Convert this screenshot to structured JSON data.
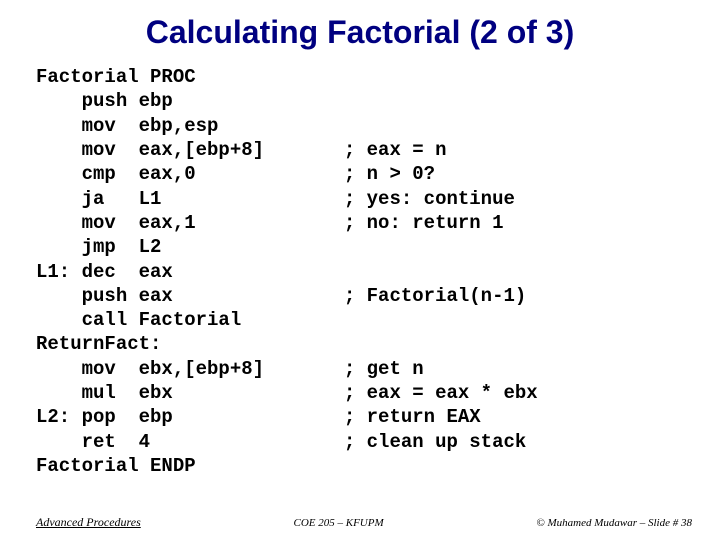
{
  "title": "Calculating Factorial  (2 of 3)",
  "code_lines": [
    "Factorial PROC",
    "    push ebp",
    "    mov  ebp,esp",
    "    mov  eax,[ebp+8]       ; eax = n",
    "    cmp  eax,0             ; n > 0?",
    "    ja   L1                ; yes: continue",
    "    mov  eax,1             ; no: return 1",
    "    jmp  L2",
    "L1: dec  eax",
    "    push eax               ; Factorial(n-1)",
    "    call Factorial",
    "ReturnFact:",
    "    mov  ebx,[ebp+8]       ; get n",
    "    mul  ebx               ; eax = eax * ebx",
    "L2: pop  ebp               ; return EAX",
    "    ret  4                 ; clean up stack",
    "Factorial ENDP"
  ],
  "footer": {
    "left": "Advanced Procedures",
    "center": "COE 205 – KFUPM",
    "right": "© Muhamed Mudawar – Slide # 38"
  }
}
